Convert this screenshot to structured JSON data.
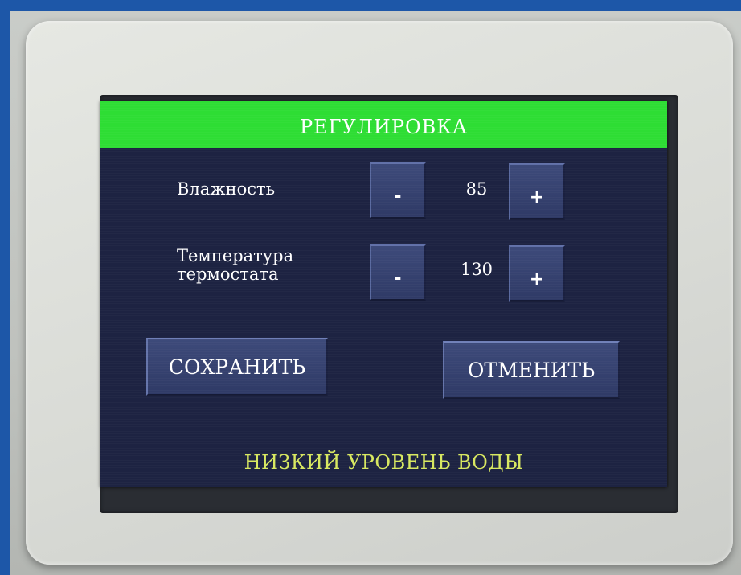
{
  "screen": {
    "title": "РЕГУЛИРОВКА",
    "params": [
      {
        "label_lines": [
          "Влажность"
        ],
        "minus_label": "-",
        "value": "85",
        "plus_label": "+"
      },
      {
        "label_lines": [
          "Температура",
          "термостата"
        ],
        "minus_label": "-",
        "value": "130",
        "plus_label": "+"
      }
    ],
    "save_label": "СОХРАНИТЬ",
    "cancel_label": "ОТМЕНИТЬ",
    "warning": "НИЗКИЙ УРОВЕНЬ ВОДЫ"
  },
  "colors": {
    "header": "#2edd34",
    "screen_background": "#1d2342",
    "button": "#34406e",
    "warning_text": "#d8e860"
  }
}
